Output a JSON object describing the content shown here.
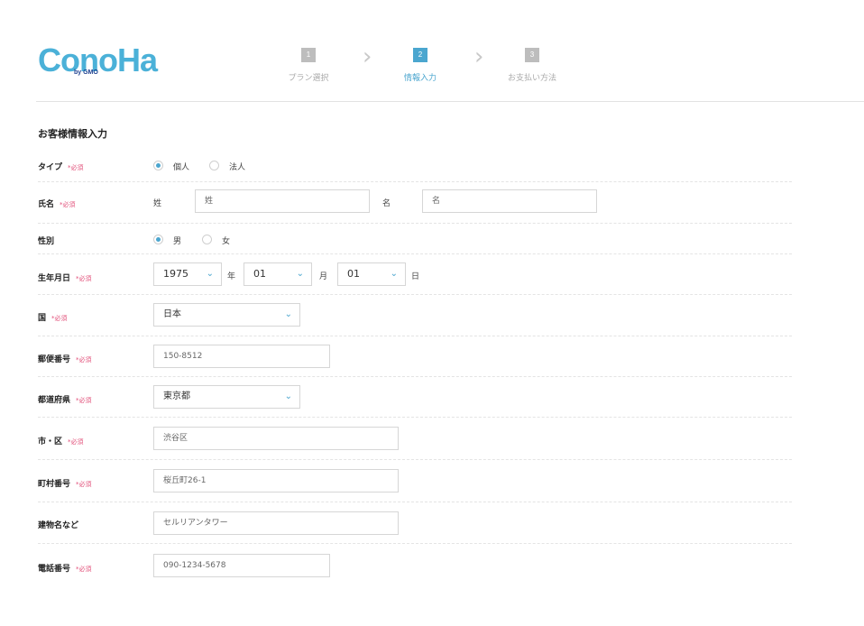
{
  "logo": {
    "text": "ConoHa",
    "sub": "by GMO"
  },
  "steps": [
    {
      "num": "1",
      "label": "プラン選択"
    },
    {
      "num": "2",
      "label": "情報入力"
    },
    {
      "num": "3",
      "label": "お支払い方法"
    }
  ],
  "section_title": "お客様情報入力",
  "required": "*必須",
  "form": {
    "type": {
      "label": "タイプ",
      "options": [
        "個人",
        "法人"
      ],
      "selected": "個人"
    },
    "name": {
      "label": "氏名",
      "last_label": "姓",
      "last_placeholder": "姓",
      "first_label": "名",
      "first_placeholder": "名"
    },
    "gender": {
      "label": "性別",
      "options": [
        "男",
        "女"
      ],
      "selected": "男"
    },
    "birth": {
      "label": "生年月日",
      "year": "1975",
      "year_unit": "年",
      "month": "01",
      "month_unit": "月",
      "day": "01",
      "day_unit": "日"
    },
    "country": {
      "label": "国",
      "value": "日本"
    },
    "zip": {
      "label": "郵便番号",
      "placeholder": "150-8512"
    },
    "prefecture": {
      "label": "都道府県",
      "value": "東京都"
    },
    "city": {
      "label": "市・区",
      "placeholder": "渋谷区"
    },
    "street": {
      "label": "町村番号",
      "placeholder": "桜丘町26-1"
    },
    "building": {
      "label": "建物名など",
      "placeholder": "セルリアンタワー"
    },
    "phone": {
      "label": "電話番号",
      "placeholder": "090-1234-5678"
    }
  },
  "colors": {
    "accent": "#4ba6cf",
    "required": "#e2507a",
    "logo": "#4bb1d8"
  }
}
